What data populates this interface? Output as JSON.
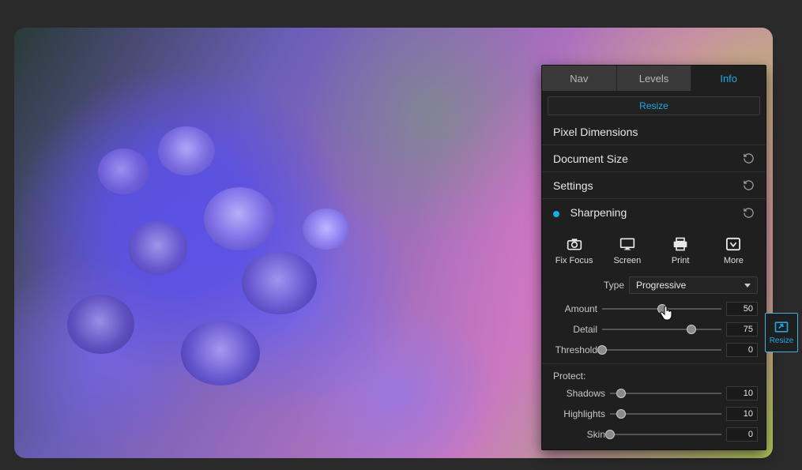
{
  "tabs": [
    {
      "label": "Nav",
      "active": false
    },
    {
      "label": "Levels",
      "active": false
    },
    {
      "label": "Info",
      "active": true
    }
  ],
  "resize_button": "Resize",
  "sections": {
    "pixel_dimensions": "Pixel Dimensions",
    "document_size": "Document Size",
    "settings": "Settings",
    "sharpening": "Sharpening"
  },
  "presets": {
    "fix_focus": "Fix Focus",
    "screen": "Screen",
    "print": "Print",
    "more": "More"
  },
  "type": {
    "label": "Type",
    "value": "Progressive"
  },
  "sliders": {
    "amount": {
      "label": "Amount",
      "value": 50,
      "pos": 50
    },
    "detail": {
      "label": "Detail",
      "value": 75,
      "pos": 75
    },
    "threshold": {
      "label": "Threshold",
      "value": 0,
      "pos": 0
    }
  },
  "protect": {
    "label": "Protect:",
    "shadows": {
      "label": "Shadows",
      "value": 10,
      "pos": 10
    },
    "highlights": {
      "label": "Highlights",
      "value": 10,
      "pos": 10
    },
    "skin": {
      "label": "Skin",
      "value": 0,
      "pos": 0
    }
  },
  "float_tool": {
    "label": "Resize"
  }
}
